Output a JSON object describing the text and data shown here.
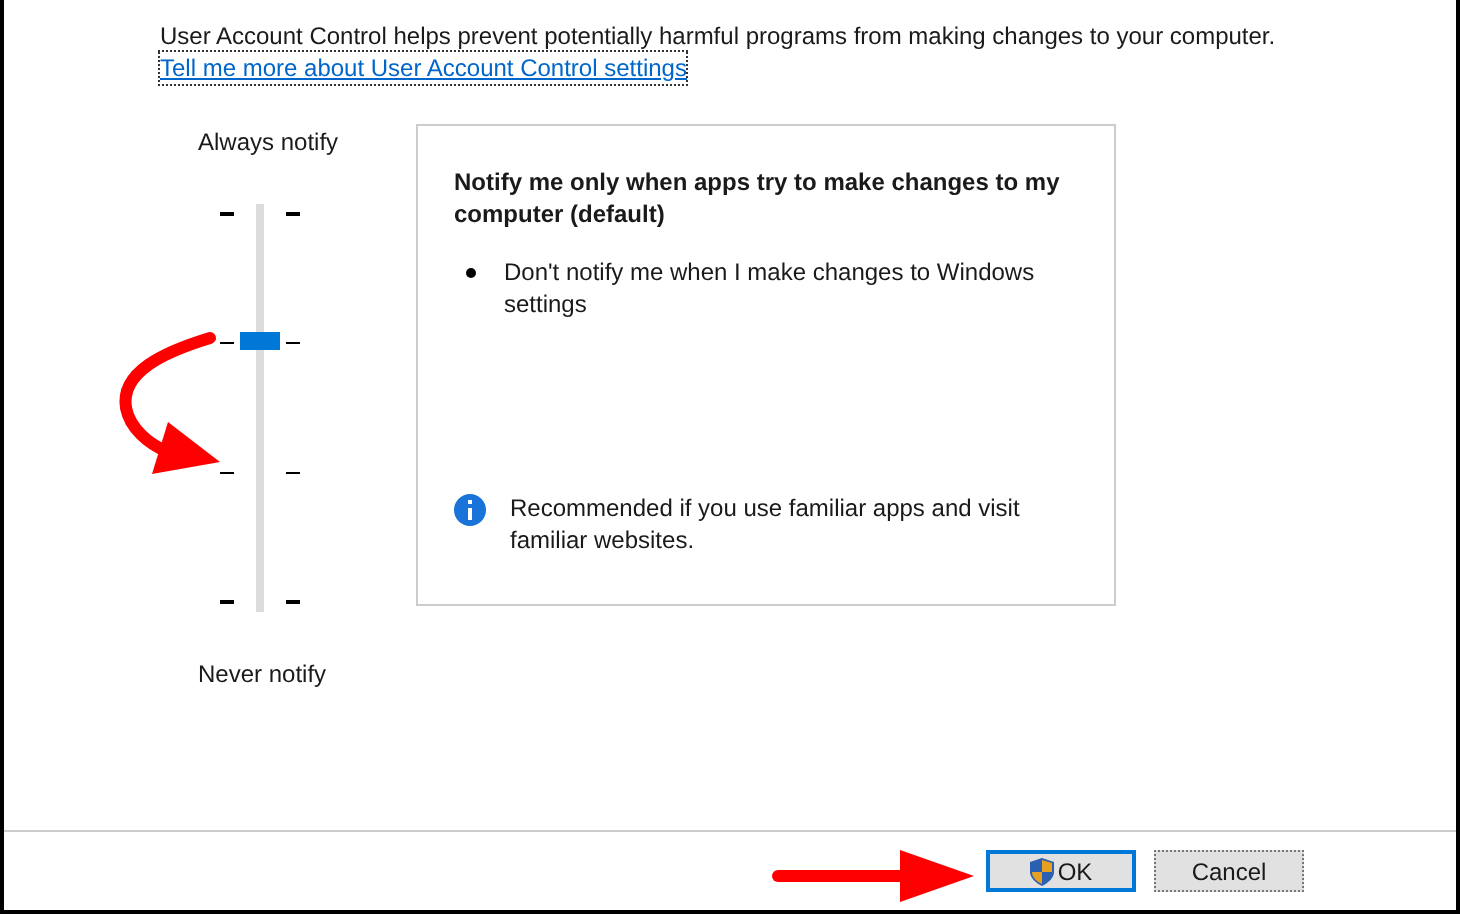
{
  "intro": "User Account Control helps prevent potentially harmful programs from making changes to your computer.",
  "link": "Tell me more about User Account Control settings",
  "slider": {
    "top_label": "Always notify",
    "bottom_label": "Never notify",
    "level": 0.667
  },
  "description": {
    "title": "Notify me only when apps try to make changes to my computer (default)",
    "bullets": [
      "Don't notify me when I make changes to Windows settings"
    ],
    "note": "Recommended if you use familiar apps and visit familiar websites."
  },
  "buttons": [
    {
      "label": "OK",
      "default": true,
      "shield": true
    },
    {
      "label": "Cancel",
      "default": false,
      "shield": false
    }
  ]
}
